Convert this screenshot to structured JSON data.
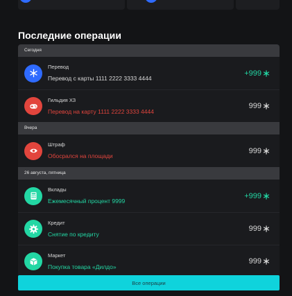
{
  "section_title": "Последние операции",
  "colors": {
    "positive": "#23d7a4",
    "negative": "#e2453d",
    "neutral": "#d8d8d8",
    "accent": "#0fd3dc"
  },
  "groups": [
    {
      "label": "Сегодня",
      "items": [
        {
          "name": "Перевод",
          "desc": "Перевод с карты 1111 2222 3333 4444",
          "amount": "+999",
          "icon": "snowflake-icon"
        },
        {
          "name": "Гильдия ХЗ",
          "desc": "Перевод на карту 1111 2222 3333 4444",
          "amount": "999",
          "icon": "gamepad-icon"
        }
      ]
    },
    {
      "label": "Вчера",
      "items": [
        {
          "name": "Штраф",
          "desc": "Обосрался на площади",
          "amount": "999",
          "icon": "eye-icon"
        }
      ]
    },
    {
      "label": "26 августа, пятница",
      "items": [
        {
          "name": "Вклады",
          "desc": "Ежемесячный процент 9999",
          "amount": "+999",
          "icon": "calculator-icon"
        },
        {
          "name": "Кредит",
          "desc": "Снятие по кредиту",
          "amount": "999",
          "icon": "gear-badge-icon"
        },
        {
          "name": "Маркет",
          "desc": "Покупка товара «Дилдо»",
          "amount": "999",
          "icon": "box-icon"
        }
      ]
    }
  ],
  "all_button_label": "Все операции"
}
